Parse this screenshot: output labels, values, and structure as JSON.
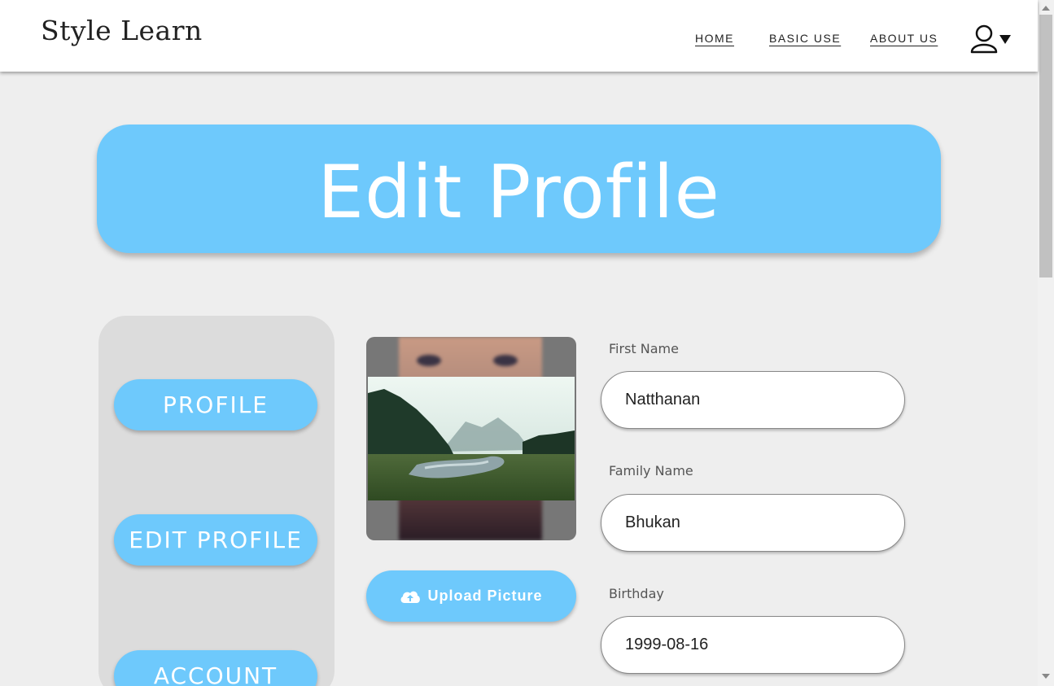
{
  "header": {
    "logo_text": "Style Learn",
    "nav": [
      {
        "label": "HOME"
      },
      {
        "label": "BASIC USE"
      },
      {
        "label": "ABOUT US"
      }
    ],
    "user_icon": "user-icon",
    "dropdown_icon": "caret-down-icon"
  },
  "banner": {
    "title": "Edit Profile"
  },
  "side_menu": {
    "items": [
      {
        "label": "PROFILE"
      },
      {
        "label": "EDIT PROFILE"
      },
      {
        "label": "ACCOUNT"
      }
    ]
  },
  "photo": {
    "upload_label": "Upload Picture",
    "upload_icon": "cloud-upload-icon"
  },
  "form": {
    "first_name_label": "First Name",
    "first_name_value": "Natthanan",
    "family_name_label": "Family Name",
    "family_name_value": "Bhukan",
    "birthday_label": "Birthday",
    "birthday_value": "1999-08-16"
  },
  "colors": {
    "accent": "#6ec9fc",
    "background": "#eeeeee",
    "panel": "#dcdcdc"
  }
}
